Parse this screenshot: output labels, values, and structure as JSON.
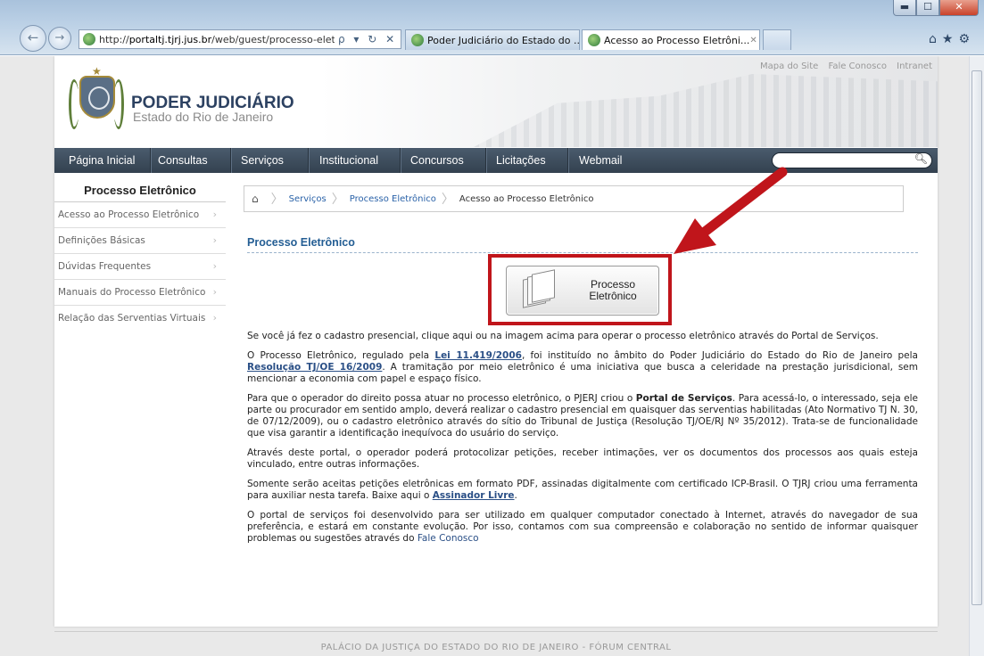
{
  "browser": {
    "url_prefix": "http://",
    "url_host": "portaltj.tjrj.jus.br",
    "url_path": "/web/guest/processo-elet",
    "address_tools": "ρ ▾ ↻ ✕",
    "tabs": [
      {
        "label": "Poder Judiciário do Estado do ..."
      },
      {
        "label": "Acesso ao Processo Eletrôni...",
        "close": "✕"
      }
    ],
    "window_buttons": {
      "minimize": "▬",
      "maximize": "☐",
      "close": "✕"
    },
    "toolbar_icons": [
      "home-icon",
      "favorites-star-icon",
      "settings-gear-icon"
    ]
  },
  "top_links": [
    "Mapa do Site",
    "Fale Conosco",
    "Intranet"
  ],
  "logo": {
    "title": "PODER JUDICIÁRIO",
    "subtitle": "Estado do Rio de Janeiro"
  },
  "nav": [
    "Página Inicial",
    "Consultas",
    "Serviços",
    "Institucional",
    "Concursos",
    "Licitações",
    "Webmail"
  ],
  "sidebar": {
    "title": "Processo Eletrônico",
    "items": [
      {
        "label": "Acesso ao Processo Eletrônico"
      },
      {
        "label": "Definições Básicas"
      },
      {
        "label": "Dúvidas Frequentes"
      },
      {
        "label": "Manuais do Processo Eletrônico"
      },
      {
        "label": "Relação das Serventias Virtuais"
      }
    ]
  },
  "breadcrumb": {
    "items": [
      "Serviços",
      "Processo Eletrônico"
    ],
    "current": "Acesso ao Processo Eletrônico"
  },
  "main": {
    "title": "Processo Eletrônico",
    "button_line1": "Processo",
    "button_line2": "Eletrônico",
    "p1": "Se você já fez o cadastro presencial, clique aqui ou na imagem acima para operar o processo eletrônico através do Portal de Serviços.",
    "p2_a": "O Processo Eletrônico, regulado pela ",
    "p2_link1": "Lei 11.419/2006",
    "p2_b": ", foi instituído no âmbito do Poder Judiciário do Estado do Rio de Janeiro pela ",
    "p2_link2": "Resolução TJ/OE 16/2009",
    "p2_c": ". A tramitação por meio eletrônico é uma iniciativa que busca a celeridade na prestação jurisdicional, sem mencionar a economia com papel e espaço físico.",
    "p3_a": "Para que o operador do direito possa atuar no processo eletrônico, o PJERJ criou o ",
    "p3_bold": "Portal de Serviços",
    "p3_b": ". Para acessá-lo, o interessado, seja ele parte ou procurador em sentido amplo, deverá realizar o cadastro presencial em quaisquer das serventias habilitadas (Ato Normativo TJ N. 30, de 07/12/2009), ou o cadastro eletrônico através do sítio do Tribunal de Justiça (Resolução TJ/OE/RJ Nº 35/2012). Trata-se de funcionalidade que visa garantir a identificação inequívoca do usuário do serviço.",
    "p4": "Através deste portal, o operador poderá protocolizar petições, receber intimações, ver os documentos dos processos aos quais esteja vinculado, entre outras informações.",
    "p5_a": "Somente serão aceitas petições eletrônicas em formato PDF, assinadas digitalmente com certificado ICP-Brasil. O TJRJ criou uma ferramenta para auxiliar nesta tarefa. Baixe aqui o ",
    "p5_link": "Assinador Livre",
    "p5_b": ".",
    "p6_a": "O portal de serviços foi desenvolvido para ser utilizado em qualquer computador conectado à Internet, através do navegador de sua preferência, e estará em constante evolução. Por isso, contamos com sua compreensão e colaboração no sentido de informar quaisquer problemas ou sugestões através do ",
    "p6_link": "Fale Conosco"
  },
  "footer": "PALÁCIO DA JUSTIÇA DO ESTADO DO RIO DE JANEIRO - FÓRUM CENTRAL",
  "colors": {
    "annotation_red": "#c0151b",
    "nav_bg": "#3e4d5d",
    "link_blue": "#2a62a8",
    "title_blue": "#245e94"
  }
}
